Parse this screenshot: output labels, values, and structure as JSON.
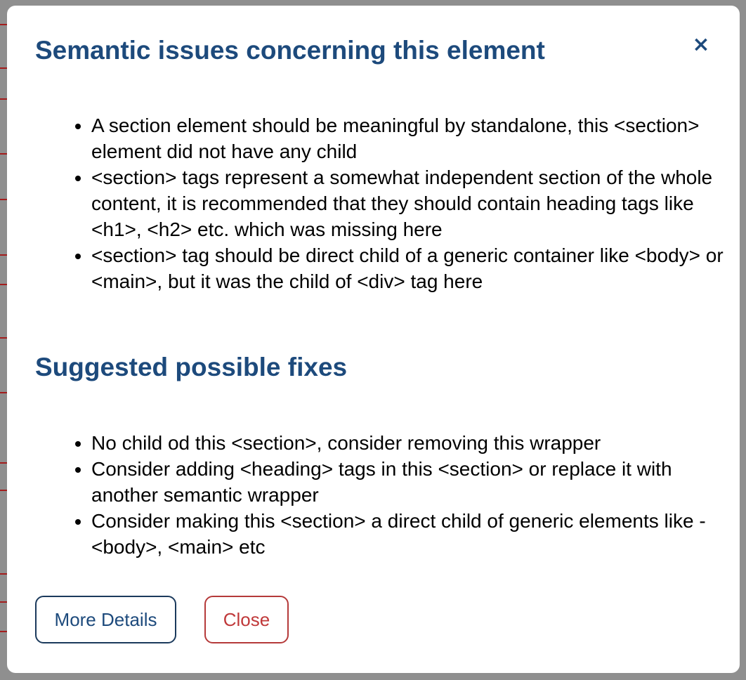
{
  "modal": {
    "title": "Semantic issues concerning this element",
    "close_icon": "×",
    "issues": [
      "A section element should be meaningful by standalone, this <section> element did not have any child",
      "<section> tags represent a somewhat independent section of the whole content, it is recommended that they should contain heading tags like <h1>, <h2> etc. which was missing here",
      "<section> tag should be direct child of a generic container like <body> or <main>, but it was the child of <div> tag here"
    ],
    "fixes_title": "Suggested possible fixes",
    "fixes": [
      "No child od this <section>, consider removing this wrapper",
      "Consider adding <heading> tags in this <section> or replace it with another semantic wrapper",
      "Consider making this <section> a direct child of generic elements like - <body>, <main> etc"
    ],
    "buttons": {
      "more_details": "More Details",
      "close": "Close"
    }
  },
  "colors": {
    "heading": "#1d4a7c",
    "close_button": "#c0393a",
    "overlay": "#8f8f8f"
  }
}
